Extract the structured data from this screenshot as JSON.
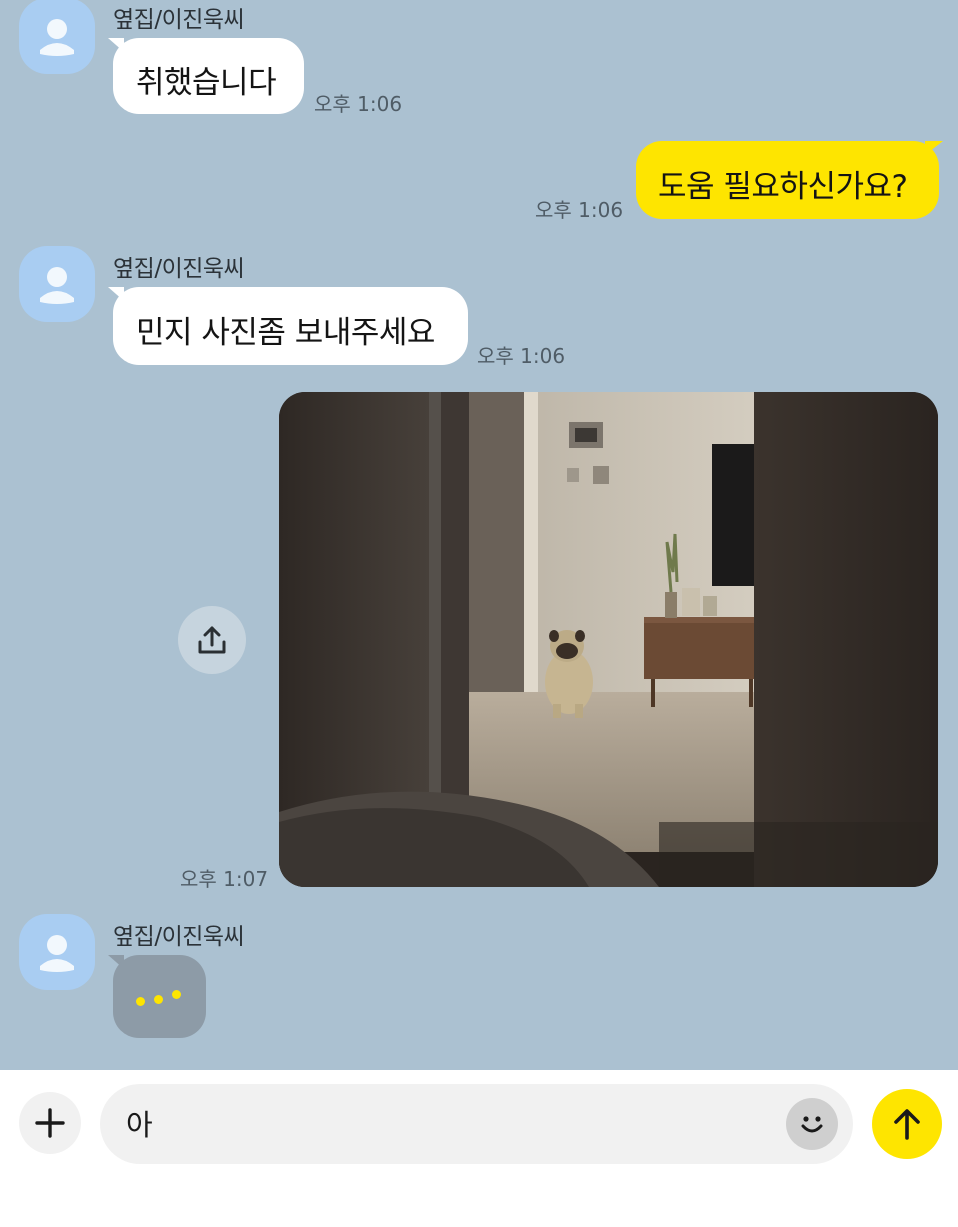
{
  "messages": [
    {
      "sender": "옆집/이진욱씨",
      "text": "취했습니다",
      "time": "오후 1:06"
    },
    {
      "text": "도움 필요하신가요?",
      "time": "오후 1:06"
    },
    {
      "sender": "옆집/이진욱씨",
      "text": "민지 사진좀 보내주세요",
      "time": "오후 1:06"
    },
    {
      "image": "pug-in-room-photo",
      "time": "오후 1:07"
    },
    {
      "sender": "옆집/이진욱씨",
      "typing": true
    }
  ],
  "composer": {
    "input_value": "아",
    "plus_icon": "plus-icon",
    "emoji_icon": "emoji-icon",
    "send_icon": "arrow-up-icon"
  },
  "colors": {
    "chat_background": "#abc1d1",
    "outgoing_bubble": "#fee500",
    "incoming_bubble": "#ffffff",
    "send_button": "#fee500"
  }
}
